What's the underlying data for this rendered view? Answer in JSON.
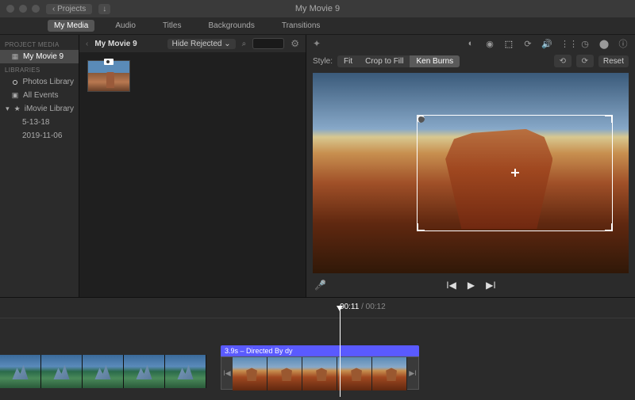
{
  "titlebar": {
    "back_label": "Projects",
    "window_title": "My Movie 9"
  },
  "tabs": {
    "my_media": "My Media",
    "audio": "Audio",
    "titles": "Titles",
    "backgrounds": "Backgrounds",
    "transitions": "Transitions"
  },
  "sidebar": {
    "project_header": "PROJECT MEDIA",
    "project_name": "My Movie 9",
    "libraries_header": "LIBRARIES",
    "photos": "Photos Library",
    "events": "All Events",
    "imovie_lib": "iMovie Library",
    "date1": "5-13-18",
    "date2": "2019-11-06"
  },
  "browser": {
    "title": "My Movie 9",
    "filter": "Hide Rejected"
  },
  "preview": {
    "style_label": "Style:",
    "seg_fit": "Fit",
    "seg_crop": "Crop to Fill",
    "seg_ken": "Ken Burns",
    "reset": "Reset"
  },
  "timeline": {
    "current": "00:11",
    "sep": " / ",
    "total": "00:12",
    "clip2_label": "3.9s – Directed By dy"
  }
}
